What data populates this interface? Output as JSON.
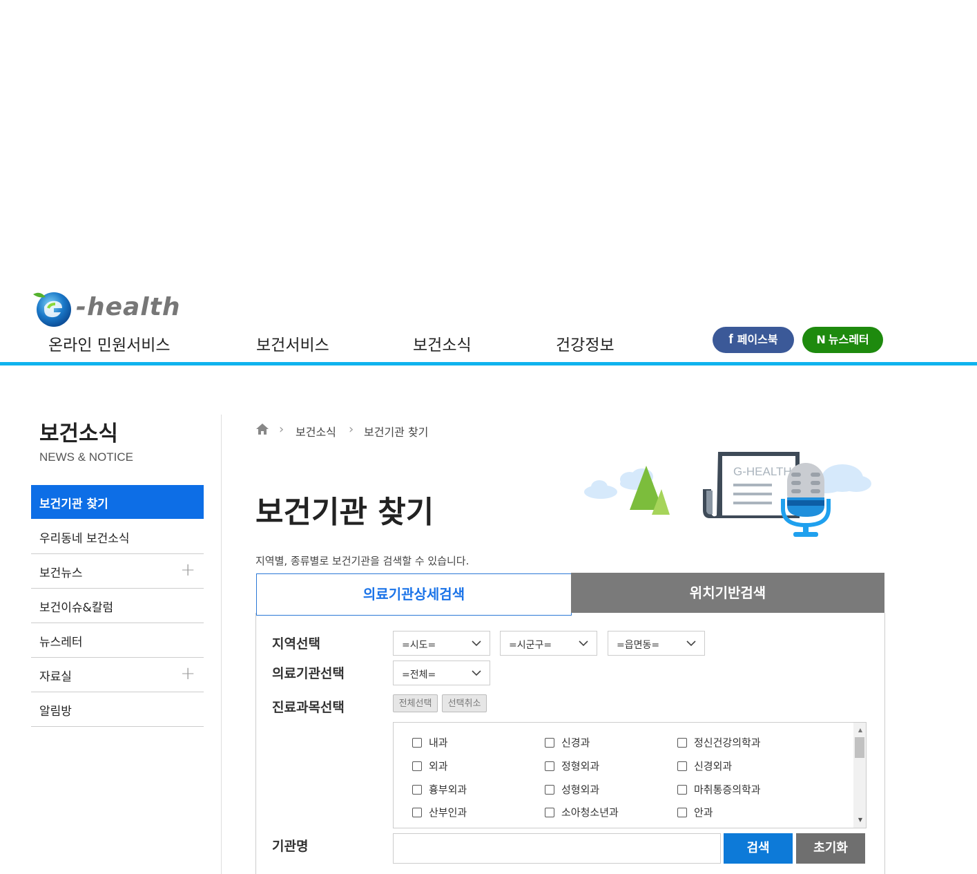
{
  "header": {
    "logo_text": "-health",
    "logo_letter": "G",
    "nav": [
      "온라인 민원서비스",
      "보건서비스",
      "보건소식",
      "건강정보"
    ],
    "facebook_label": "페이스북",
    "newsletter_label": "뉴스레터",
    "newsletter_prefix": "N",
    "facebook_icon": "f",
    "accent_color": "#0fb3ee"
  },
  "sidebar": {
    "title": "보건소식",
    "subtitle": "NEWS & NOTICE",
    "items": [
      {
        "label": "보건기관 찾기",
        "active": true,
        "expandable": false
      },
      {
        "label": "우리동네 보건소식",
        "active": false,
        "expandable": false
      },
      {
        "label": "보건뉴스",
        "active": false,
        "expandable": true
      },
      {
        "label": "보건이슈&칼럼",
        "active": false,
        "expandable": false
      },
      {
        "label": "뉴스레터",
        "active": false,
        "expandable": false
      },
      {
        "label": "자료실",
        "active": false,
        "expandable": true
      },
      {
        "label": "알림방",
        "active": false,
        "expandable": false
      }
    ],
    "active_color": "#0d6ee6"
  },
  "breadcrumb": {
    "home_icon": "home-icon",
    "items": [
      "보건소식",
      "보건기관 찾기"
    ]
  },
  "page": {
    "title": "보건기관 찾기",
    "description": "지역별, 종류별로 보건기관을 검색할 수 있습니다.",
    "illustration_text": "G-HEALTH"
  },
  "tabs": {
    "detail": "의료기관상세검색",
    "location": "위치기반검색"
  },
  "form": {
    "region_label": "지역선택",
    "sido": "=시도=",
    "sigungu": "=시군구=",
    "eupmyeondong": "=읍면동=",
    "institution_label": "의료기관선택",
    "institution_value": "=전체=",
    "dept_label": "진료과목선택",
    "select_all": "전체선택",
    "deselect": "선택취소",
    "departments": [
      [
        "내과",
        "신경과",
        "정신건강의학과"
      ],
      [
        "외과",
        "정형외과",
        "신경외과"
      ],
      [
        "흉부외과",
        "성형외과",
        "마취통증의학과"
      ],
      [
        "산부인과",
        "소아청소년과",
        "안과"
      ]
    ],
    "name_label": "기관명",
    "name_value": "",
    "search_label": "검색",
    "reset_label": "초기화"
  }
}
